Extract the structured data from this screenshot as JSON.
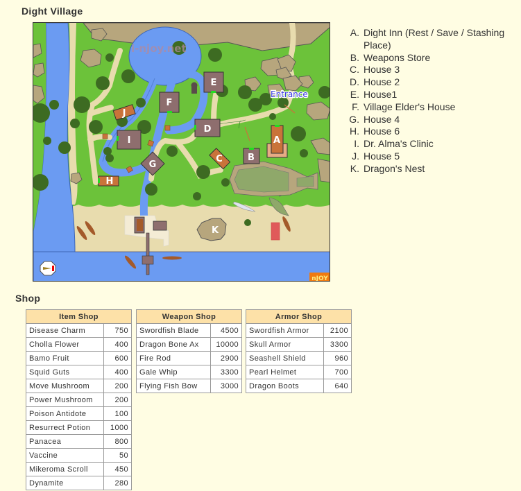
{
  "page": {
    "village_title": "Dight Village",
    "shop_title": "Shop"
  },
  "map": {
    "watermark": "i-njoy.net",
    "entrance_label": "Entrance",
    "corner_badge": "nJOY",
    "building_labels": [
      "A",
      "B",
      "C",
      "D",
      "E",
      "F",
      "G",
      "H",
      "I",
      "J",
      "K"
    ],
    "colors": {
      "grass": "#6cc23a",
      "water": "#6b9bf2",
      "sand": "#e8dcae",
      "rock": "#b7a67d",
      "tree": "#3d6b22",
      "house_gray": "#8e6e6e",
      "house_orange": "#c9733a",
      "door": "#22dd22"
    }
  },
  "legend": [
    {
      "key": "A.",
      "label": "Dight Inn (Rest / Save / Stashing Place)"
    },
    {
      "key": "B.",
      "label": "Weapons Store"
    },
    {
      "key": "C.",
      "label": "House 3"
    },
    {
      "key": "D.",
      "label": "House 2"
    },
    {
      "key": "E.",
      "label": "House1"
    },
    {
      "key": "F.",
      "label": "Village Elder's House"
    },
    {
      "key": "G.",
      "label": "House 4"
    },
    {
      "key": "H.",
      "label": "House 6"
    },
    {
      "key": "I.",
      "label": "Dr. Alma's Clinic"
    },
    {
      "key": "J.",
      "label": "House 5"
    },
    {
      "key": "K.",
      "label": "Dragon's Nest"
    }
  ],
  "shops": {
    "item": {
      "title": "Item Shop",
      "rows": [
        {
          "name": "Disease Charm",
          "price": "750"
        },
        {
          "name": "Cholla Flower",
          "price": "400"
        },
        {
          "name": "Bamo Fruit",
          "price": "600"
        },
        {
          "name": "Squid Guts",
          "price": "400"
        },
        {
          "name": "Move Mushroom",
          "price": "200"
        },
        {
          "name": "Power Mushroom",
          "price": "200"
        },
        {
          "name": "Poison Antidote",
          "price": "100"
        },
        {
          "name": "Resurrect Potion",
          "price": "1000"
        },
        {
          "name": "Panacea",
          "price": "800"
        },
        {
          "name": "Vaccine",
          "price": "50"
        },
        {
          "name": "Mikeroma Scroll",
          "price": "450"
        },
        {
          "name": "Dynamite",
          "price": "280"
        }
      ]
    },
    "weapon": {
      "title": "Weapon Shop",
      "rows": [
        {
          "name": "Swordfish Blade",
          "price": "4500"
        },
        {
          "name": "Dragon Bone Ax",
          "price": "10000"
        },
        {
          "name": "Fire Rod",
          "price": "2900"
        },
        {
          "name": "Gale Whip",
          "price": "3300"
        },
        {
          "name": "Flying Fish Bow",
          "price": "3000"
        }
      ]
    },
    "armor": {
      "title": "Armor Shop",
      "rows": [
        {
          "name": "Swordfish Armor",
          "price": "2100"
        },
        {
          "name": "Skull Armor",
          "price": "3300"
        },
        {
          "name": "Seashell Shield",
          "price": "960"
        },
        {
          "name": "Pearl Helmet",
          "price": "700"
        },
        {
          "name": "Dragon Boots",
          "price": "640"
        }
      ]
    }
  }
}
